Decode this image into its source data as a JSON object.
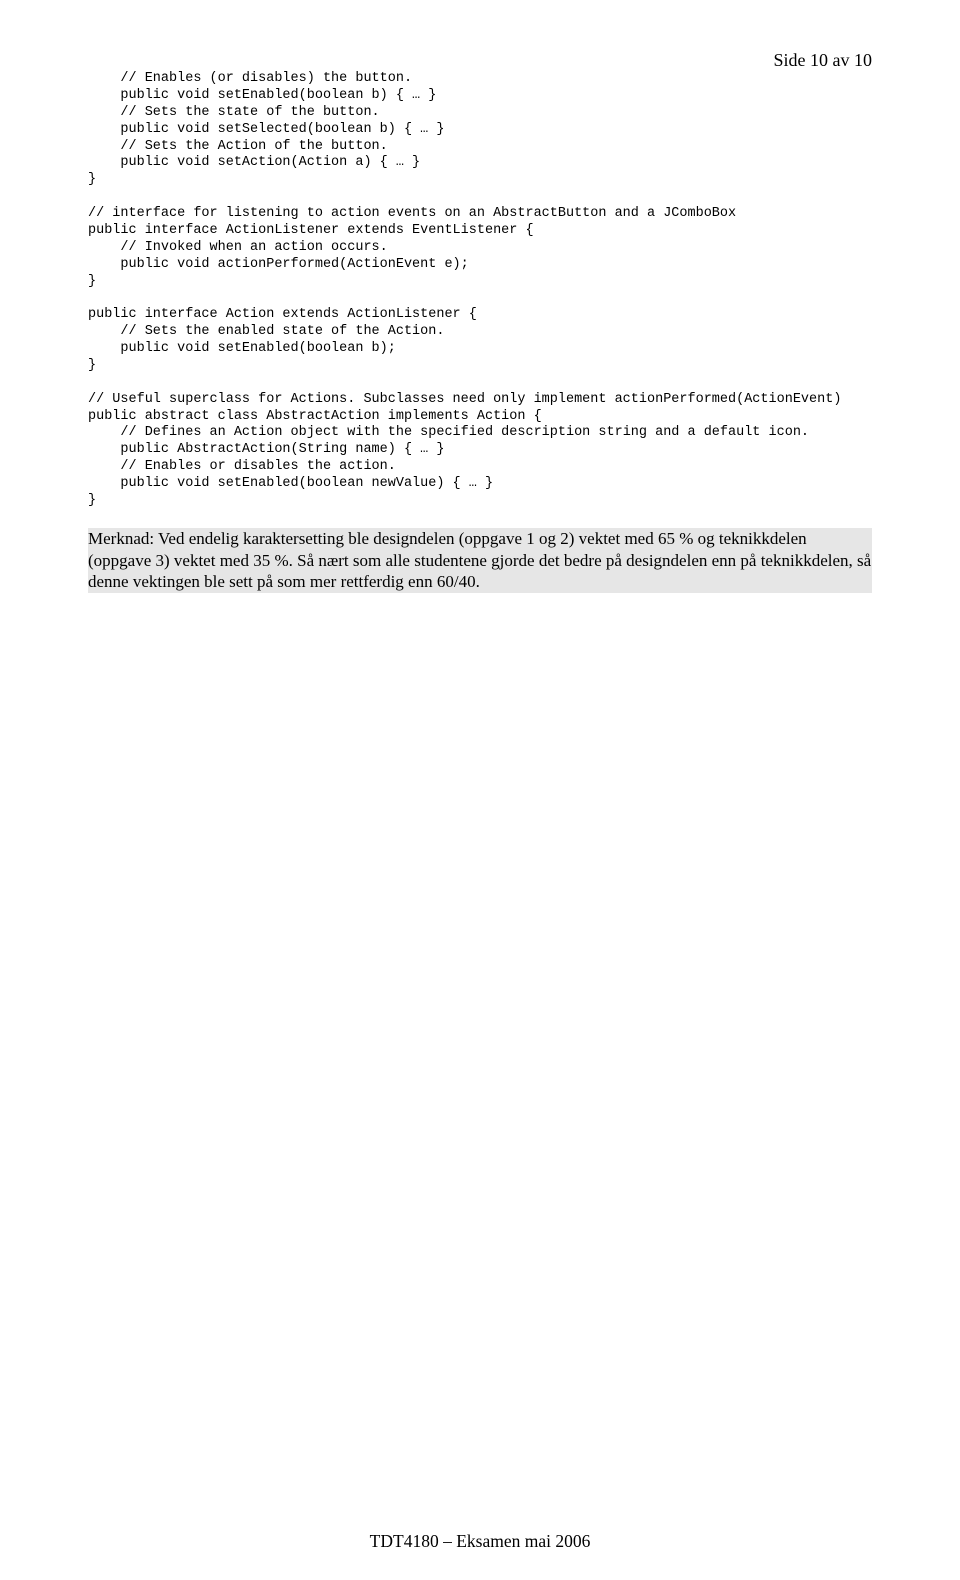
{
  "page_header": "Side 10 av 10",
  "code": "    // Enables (or disables) the button.\n    public void setEnabled(boolean b) { … }\n    // Sets the state of the button.\n    public void setSelected(boolean b) { … }\n    // Sets the Action of the button.\n    public void setAction(Action a) { … }\n}\n\n// interface for listening to action events on an AbstractButton and a JComboBox\npublic interface ActionListener extends EventListener {\n    // Invoked when an action occurs.\n    public void actionPerformed(ActionEvent e);\n}\n\npublic interface Action extends ActionListener {\n    // Sets the enabled state of the Action.\n    public void setEnabled(boolean b);\n}\n\n// Useful superclass for Actions. Subclasses need only implement actionPerformed(ActionEvent)\npublic abstract class AbstractAction implements Action {\n    // Defines an Action object with the specified description string and a default icon.\n    public AbstractAction(String name) { … }\n    // Enables or disables the action.\n    public void setEnabled(boolean newValue) { … }\n}",
  "note": "Merknad: Ved endelig karaktersetting ble designdelen (oppgave 1 og 2) vektet med 65 % og teknikkdelen (oppgave 3) vektet med 35 %. Så nært som alle studentene gjorde det bedre på designdelen enn på teknikkdelen, så denne vektingen ble sett på som mer rettferdig enn 60/40.",
  "footer": "TDT4180 – Eksamen mai 2006"
}
